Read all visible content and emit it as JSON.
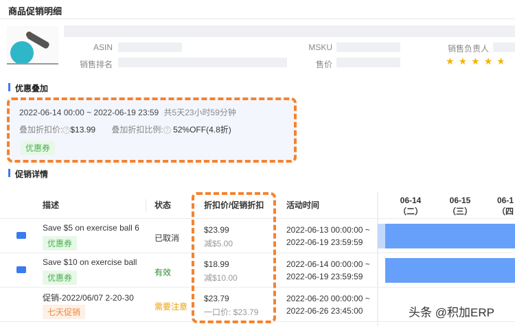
{
  "header": {
    "title": "商品促销明细"
  },
  "product": {
    "asin_label": "ASIN",
    "msku_label": "MSKU",
    "owner_label": "销售负责人",
    "rank_label": "销售排名",
    "price_label": "售价",
    "rating": 4.5
  },
  "stack": {
    "section_title": "优惠叠加",
    "period": "2022-06-14 00:00 ~ 2022-06-19 23:59",
    "duration": "共5天23小时59分钟",
    "price_label": "叠加折扣价:",
    "price": "$13.99",
    "ratio_label": "叠加折扣比例:",
    "ratio": "52%OFF(4.8折)",
    "tag": "优惠券",
    "help": "?"
  },
  "details": {
    "section_title": "促销详情",
    "columns": [
      "描述",
      "状态",
      "折扣价/促销折扣",
      "活动时间"
    ],
    "dates": [
      {
        "d": "06-14",
        "w": "（二）"
      },
      {
        "d": "06-15",
        "w": "（三）"
      },
      {
        "d": "06-1",
        "w": "（四"
      }
    ],
    "rows": [
      {
        "desc": "Save $5 on exercise ball 6",
        "tag": "优惠券",
        "status": "已取消",
        "price": "$23.99",
        "sub": "减$5.00",
        "start": "2022-06-13 00:00:00 ~",
        "end": "2022-06-19 23:59:59"
      },
      {
        "desc": "Save $10 on exercise ball",
        "tag": "优惠券",
        "status": "有效",
        "price": "$18.99",
        "sub": "减$10.00",
        "start": "2022-06-14 00:00:00 ~",
        "end": "2022-06-19 23:59:59"
      },
      {
        "desc": "促销-2022/06/07 2-20-30",
        "tag": "七天促销",
        "status": "需要注意",
        "price": "$23.79",
        "sub": "一口价: $23.79",
        "start": "2022-06-20 00:00:00 ~",
        "end": "2022-06-26 23:45:00"
      }
    ]
  },
  "watermark": "头条 @积加ERP"
}
